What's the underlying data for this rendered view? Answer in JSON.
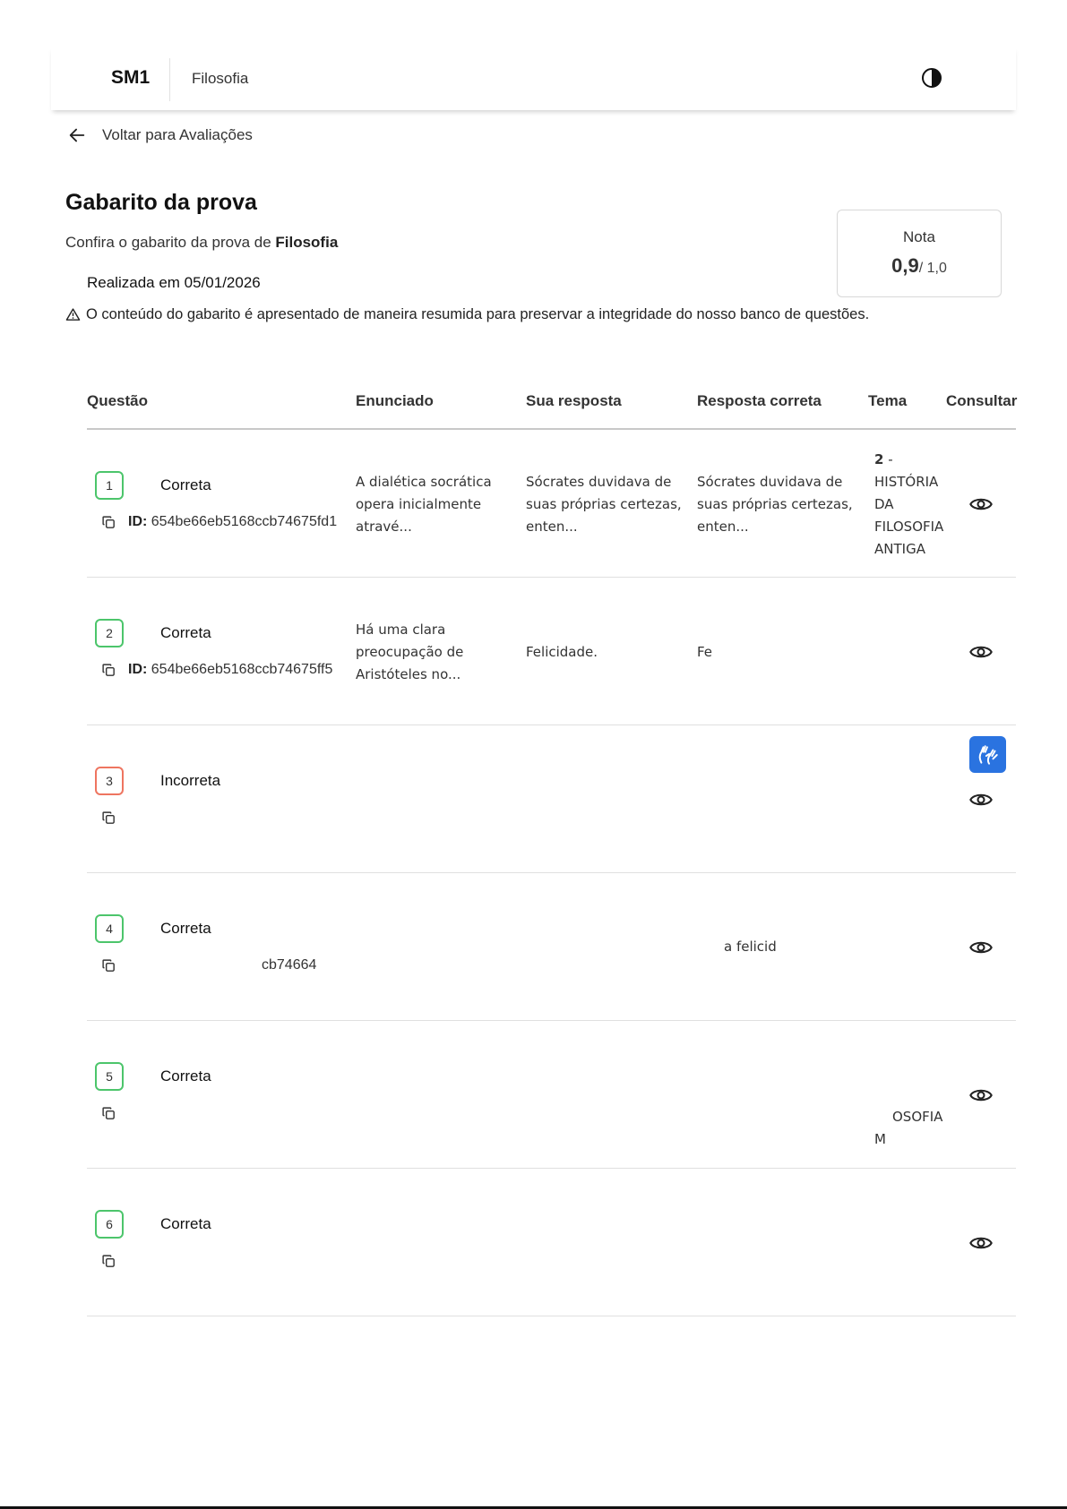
{
  "header": {
    "brand": "SM1",
    "subject": "Filosofia",
    "theme_icon": "contrast-icon"
  },
  "back_link": {
    "label": "Voltar para Avaliações",
    "icon": "arrow-left-icon"
  },
  "page": {
    "title": "Gabarito da prova",
    "subtitle_prefix": "Confira o gabarito da prova de ",
    "subtitle_subject": "Filosofia",
    "date_line": "Realizada em 05/01/2026",
    "notice": "O conteúdo do gabarito é apresentado de maneira resumida para preservar a integridade do nosso banco de questões.",
    "notice_icon": "warning-icon"
  },
  "grade": {
    "label": "Nota",
    "value": "0,9",
    "total": "/ 1,0"
  },
  "table": {
    "columns": [
      "Questão",
      "Enunciado",
      "Sua resposta",
      "Resposta correta",
      "Tema",
      "Consultar"
    ],
    "rows": [
      {
        "num": "1",
        "status": "Correta",
        "correct": true,
        "id_label": "ID:",
        "id": "654be66eb5168ccb74675fd1",
        "enunciado": "A dialética socrática opera inicialmente atravé...",
        "sua": "Sócrates duvidava de suas próprias certezas, enten...",
        "correta": "Sócrates duvidava de suas próprias certezas, enten...",
        "tema_num": "2",
        "tema_text": " - HISTÓRIA DA FILOSOFIA ANTIGA"
      },
      {
        "num": "2",
        "status": "Correta",
        "correct": true,
        "id_label": "ID:",
        "id": "654be66eb5168ccb74675ff5",
        "enunciado": "Há uma clara preocupação de Aristóteles no...",
        "sua": "Felicidade.",
        "correta": "Fe",
        "tema_num": "",
        "tema_text": ""
      },
      {
        "num": "3",
        "status": "Incorreta",
        "correct": false,
        "id_label": "",
        "id": "",
        "enunciado": "",
        "sua": "",
        "correta": "",
        "tema_num": "",
        "tema_text": ""
      },
      {
        "num": "4",
        "status": "Correta",
        "correct": true,
        "id_label": "",
        "id": "cb74664",
        "enunciado": "",
        "sua": "",
        "correta": "a felicid",
        "tema_num": "",
        "tema_text": ""
      },
      {
        "num": "5",
        "status": "Correta",
        "correct": true,
        "id_label": "",
        "id": "",
        "enunciado": "",
        "sua": "",
        "correta": "",
        "tema_num": "",
        "tema_text": "OSOFIA M"
      },
      {
        "num": "6",
        "status": "Correta",
        "correct": true,
        "id_label": "",
        "id": "",
        "enunciado": "",
        "sua": "",
        "correta": "",
        "tema_num": "",
        "tema_text": ""
      }
    ]
  },
  "accessibility_button_icon": "sign-language-hands-icon",
  "colors": {
    "correct_border": "#4cc56b",
    "incorrect_border": "#ee7560",
    "accessibility_blue": "#2a73e0"
  }
}
